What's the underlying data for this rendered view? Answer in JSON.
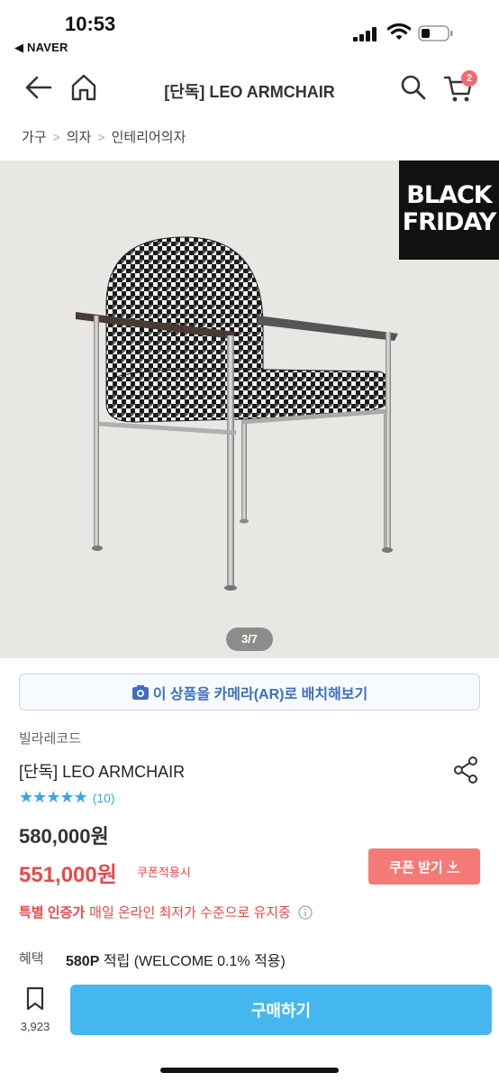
{
  "status": {
    "time": "10:53",
    "back_app": "◀ NAVER"
  },
  "header": {
    "title": "[단독] LEO ARMCHAIR",
    "cart_count": "2"
  },
  "breadcrumb": [
    "가구",
    "의자",
    "인테리어의자"
  ],
  "image": {
    "badge_line1": "BLACK",
    "badge_line2": "FRIDAY",
    "counter": "3/7"
  },
  "ar_button": "이 상품을 카메라(AR)로 배치해보기",
  "product": {
    "brand": "빌라레코드",
    "name": "[단독] LEO ARMCHAIR",
    "stars": "★★★★★",
    "rating": 5,
    "review_count": "(10)",
    "original_price": "580,000원",
    "sale_price": "551,000원",
    "sale_note": "쿠폰적용시",
    "coupon_button": "쿠폰 받기",
    "cert_bold": "특별 인증가",
    "cert_text": "매일 온라인 최저가 수준으로 유지중",
    "benefit_label": "혜택",
    "benefit_points": "580P",
    "benefit_text": " 적립 (WELCOME 0.1% 적용)"
  },
  "bottom": {
    "wish_count": "3,923",
    "buy_label": "구매하기"
  },
  "colors": {
    "accent": "#45b7ef",
    "sale": "#e8494b",
    "coupon": "#f47a77",
    "ar_text": "#3e6fc0"
  }
}
